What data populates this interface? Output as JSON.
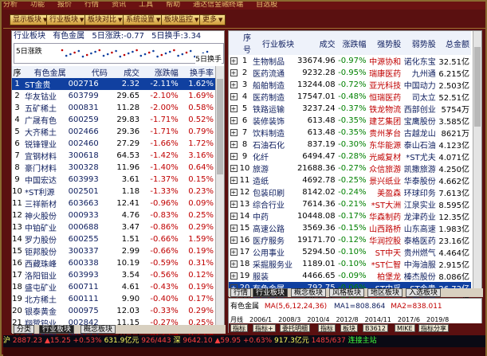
{
  "topbar": {
    "items": [
      "分析",
      "功能",
      "报价",
      "行情",
      "资讯",
      "工具",
      "帮助",
      "通达信金融终端",
      "自选股"
    ]
  },
  "toolbar": {
    "buttons": [
      "显示板块",
      "行业板块",
      "板块对比",
      "系统设置",
      "板块监控",
      "更多"
    ]
  },
  "left": {
    "header": {
      "title": "行业板块",
      "board": "有色金属",
      "rise": "5日涨跌:-0.77",
      "turn": "5日换手:3.34"
    },
    "spark": {
      "left_label": "5日涨跌",
      "right_label": "5日换手"
    },
    "columns": [
      "序",
      "有色金属",
      "代码",
      "成交",
      "涨跌幅",
      "换手率"
    ],
    "rows": [
      [
        "1",
        "ST金贵",
        "002716",
        "2.32",
        "-2.11%",
        "1.62%"
      ],
      [
        "2",
        "华友钴业",
        "603799",
        "29.65",
        "-2.10%",
        "1.69%"
      ],
      [
        "3",
        "五矿稀土",
        "000831",
        "11.28",
        "-2.00%",
        "0.58%"
      ],
      [
        "4",
        "广晟有色",
        "600259",
        "29.83",
        "-1.71%",
        "0.52%"
      ],
      [
        "5",
        "大齐稀土",
        "002466",
        "29.36",
        "-1.71%",
        "0.79%"
      ],
      [
        "6",
        "锐锋锂业",
        "002460",
        "27.29",
        "-1.66%",
        "1.72%"
      ],
      [
        "7",
        "宜钢材料",
        "300618",
        "64.53",
        "-1.42%",
        "3.16%"
      ],
      [
        "8",
        "豪门材料",
        "300328",
        "11.96",
        "-1.40%",
        "0.64%"
      ],
      [
        "9",
        "中国宏达",
        "603993",
        "3.61",
        "-1.37%",
        "0.15%"
      ],
      [
        "10",
        "*ST利源",
        "002501",
        "1.18",
        "-1.33%",
        "0.23%"
      ],
      [
        "11",
        "三祥新材",
        "603663",
        "12.41",
        "-0.96%",
        "0.09%"
      ],
      [
        "12",
        "神火股份",
        "000933",
        "4.76",
        "-0.83%",
        "0.25%"
      ],
      [
        "13",
        "中铂矿业",
        "000688",
        "3.47",
        "-0.86%",
        "0.29%"
      ],
      [
        "14",
        "罗力股份",
        "600255",
        "1.51",
        "-0.66%",
        "1.59%"
      ],
      [
        "15",
        "钜邦股份",
        "300337",
        "2.99",
        "-0.66%",
        "0.19%"
      ],
      [
        "16",
        "西藏珠峰",
        "600338",
        "10.19",
        "-0.59%",
        "0.31%"
      ],
      [
        "17",
        "洛阳钼业",
        "603993",
        "3.54",
        "-0.56%",
        "0.12%"
      ],
      [
        "18",
        "盛屯矿业",
        "600711",
        "4.61",
        "-0.43%",
        "0.19%"
      ],
      [
        "19",
        "北方稀土",
        "600111",
        "9.90",
        "-0.40%",
        "0.17%"
      ],
      [
        "20",
        "银泰黄金",
        "000975",
        "12.03",
        "-0.33%",
        "0.29%"
      ],
      [
        "21",
        "翔鹭钨业",
        "002842",
        "11.15",
        "-0.27%",
        "0.25%"
      ],
      [
        "22",
        "海星股份",
        "603115",
        "20.15",
        "-0.25%",
        "0.25%"
      ],
      [
        "23",
        "盛达资源",
        "000603",
        "11.92",
        "-0.25%",
        "0.10%"
      ]
    ],
    "tabs": [
      "分类",
      "行业板块",
      "概念板块"
    ]
  },
  "right": {
    "columns": [
      "",
      "序号",
      "行业板块",
      "成交",
      "涨跌幅",
      "强势股",
      "弱势股",
      "总金额"
    ],
    "rows": [
      [
        "1",
        "生物制品",
        "33674.96",
        "-0.97%",
        "中源协和",
        "诺化东宝",
        "32.51亿"
      ],
      [
        "2",
        "医药流通",
        "9232.28",
        "-0.95%",
        "瑞康医药",
        "九州通",
        "6.215亿"
      ],
      [
        "3",
        "船舶制造",
        "13244.08",
        "-0.72%",
        "亚光科技",
        "中国动力",
        "2.503亿"
      ],
      [
        "4",
        "医药制造",
        "17547.01",
        "-0.48%",
        "恒瑞医药",
        "司太立",
        "52.51亿"
      ],
      [
        "5",
        "铁路运输",
        "3237.24",
        "-0.37%",
        "铁龙物流",
        "西部创业",
        "5754万"
      ],
      [
        "6",
        "装修装饰",
        "613.48",
        "-0.35%",
        "建艺集团",
        "宝鹰股份",
        "3.585亿"
      ],
      [
        "7",
        "饮料制造",
        "613.48",
        "-0.35%",
        "贵州茅台",
        "古越龙山",
        "8621万"
      ],
      [
        "8",
        "石油石化",
        "837.19",
        "-0.30%",
        "东华能源",
        "泰山石油",
        "4.123亿"
      ],
      [
        "9",
        "化纤",
        "6494.47",
        "-0.28%",
        "光威复材",
        "*ST尤夫",
        "4.071亿"
      ],
      [
        "10",
        "旅游",
        "21688.36",
        "-0.27%",
        "众信旅游",
        "凯撒旅游",
        "4.250亿"
      ],
      [
        "11",
        "造纸",
        "4692.78",
        "-0.25%",
        "景兴纸业",
        "华泰股份",
        "4.662亿"
      ],
      [
        "12",
        "包装印刷",
        "8142.02",
        "-0.24%",
        "美盈森",
        "环球印务",
        "7.613亿"
      ],
      [
        "13",
        "综合行业",
        "7614.36",
        "-0.21%",
        "*ST大洲",
        "江泉实业",
        "8.595亿"
      ],
      [
        "14",
        "中药",
        "10448.08",
        "-0.17%",
        "华森制药",
        "龙津药业",
        "12.35亿"
      ],
      [
        "15",
        "高速公路",
        "3569.36",
        "-0.15%",
        "山西路桥",
        "山东高速",
        "1.983亿"
      ],
      [
        "16",
        "医疗服务",
        "19171.70",
        "-0.12%",
        "华润控股",
        "泰格医药",
        "23.16亿"
      ],
      [
        "17",
        "公用事业",
        "5294.50",
        "-0.10%",
        "ST中天",
        "贵州燃气",
        "4.464亿"
      ],
      [
        "18",
        "采掘服务业",
        "1189.01",
        "-0.10%",
        "*ST仁智",
        "中海油服",
        "2.915亿"
      ],
      [
        "19",
        "服装",
        "4466.65",
        "-0.09%",
        "柏堡龙",
        "榛杰股份",
        "8.086亿"
      ],
      [
        "20",
        "有色金属",
        "792.75",
        "-0.06%",
        "ST中孚",
        "ST金贵",
        "26.72亿"
      ],
      [
        "21",
        "轻工产品",
        "3856.36",
        "-0.01%",
        "开润股份",
        "山东华鹏",
        "4.809亿"
      ],
      [
        "22",
        "农林",
        "7460.59",
        "-0.05%",
        "隆平高科",
        "新农开发",
        "4.224亿"
      ],
      [
        "23",
        "仓储物流",
        "7043.28",
        "-0.05%",
        "保税科技",
        "*ST欧浦",
        "9.742亿"
      ]
    ],
    "tabs": [
      "行情",
      "行业板块",
      "概念板块",
      "风格板块",
      "地区板块",
      "入选板块"
    ]
  },
  "kline": {
    "title": "有色金属",
    "ind": "MA(5,6,12,24,36)",
    "ma1": "MA1=808.864",
    "ma2": "MA2=838.011",
    "axis": [
      "月线",
      "2006/1",
      "2008/3",
      "2010/4",
      "2012/8",
      "2014/11",
      "2017/6",
      "2019/8"
    ],
    "buttons": [
      "指标",
      "指标+",
      "委托明细",
      "指标",
      "板块",
      "B3612",
      "MIKE",
      "指标分享"
    ]
  },
  "status": {
    "sh_label": "沪",
    "sh_val": "2887.23",
    "sh_chg": "▲15.25",
    "sh_pct": "+0.53%",
    "sh_amt": "631.9亿元",
    "sh_ud": "926/443",
    "sz_label": "深",
    "sz_val": "9642.10",
    "sz_chg": "▲59.95",
    "sz_pct": "+0.63%",
    "sz_amt": "917.3亿元",
    "sz_ud": "1485/637",
    "tail": "连接主站"
  },
  "colors": {
    "frame": "#5a1010",
    "accent": "#1040a0",
    "up": "#c00000",
    "down": "#008000"
  }
}
